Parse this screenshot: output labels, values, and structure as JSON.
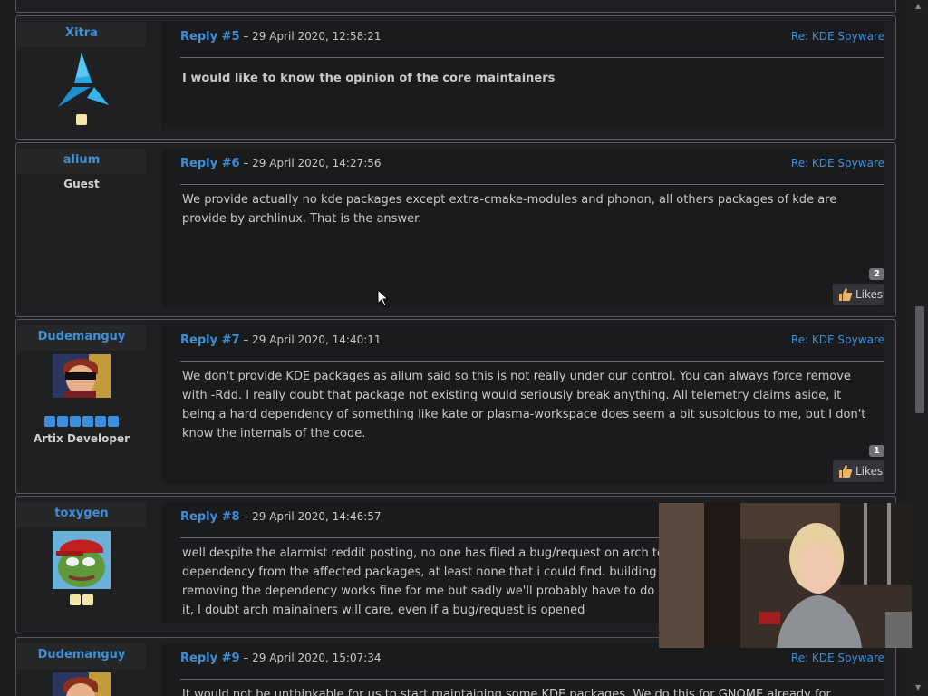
{
  "posts": [
    {
      "author": "Xitra",
      "reply_label": "Reply #5",
      "date": " – 29 April 2020, 12:58:21",
      "subject": "Re: KDE Spyware",
      "body": "I would like to know the opinion of the core maintainers"
    },
    {
      "author": "alium",
      "role": "Guest",
      "reply_label": "Reply #6",
      "date": " – 29 April 2020, 14:27:56",
      "subject": "Re: KDE Spyware",
      "body": "We provide actually no kde packages except extra-cmake-modules and phonon, all others packages of kde are provide by archlinux. That is the answer.",
      "likes_count": "2",
      "likes_label": "Likes"
    },
    {
      "author": "Dudemanguy",
      "role": "Artix Developer",
      "reply_label": "Reply #7",
      "date": " – 29 April 2020, 14:40:11",
      "subject": "Re: KDE Spyware",
      "body": "We don't provide KDE packages as alium said so this is not really under our control. You can always force remove with -Rdd. I really doubt that package not existing would seriously break anything. All telemetry claims aside, it being a hard dependency of something like kate or plasma-workspace does seem a bit suspicious to me, but I don't know the internals of the code.",
      "likes_count": "1",
      "likes_label": "Likes"
    },
    {
      "author": "toxygen",
      "reply_label": "Reply #8",
      "date": " – 29 April 2020, 14:46:57",
      "body_lines": [
        "well despite the alarmist reddit posting, no one has filed a bug/request on arch to hav",
        "dependency from the affected packages, at least none that i could find.  building both",
        "removing the dependency works fine for me but sadly we'll probably have to do so fr",
        "it,  I doubt arch mainainers will care, even if a bug/request is opened"
      ]
    },
    {
      "author": "Dudemanguy",
      "reply_label": "Reply #9",
      "date": " – 29 April 2020, 15:07:34",
      "subject": "Re: KDE Spyware",
      "body": "It would not be unthinkable for us to start maintaining some KDE packages. We do this for GNOME already for example. I"
    }
  ],
  "colors": {
    "link": "#3f8fd6",
    "background": "#1c1d1f",
    "border": "#55575a"
  },
  "icons": [
    "artix-logo-icon",
    "thumbs-up-icon",
    "mouse-cursor-icon"
  ]
}
